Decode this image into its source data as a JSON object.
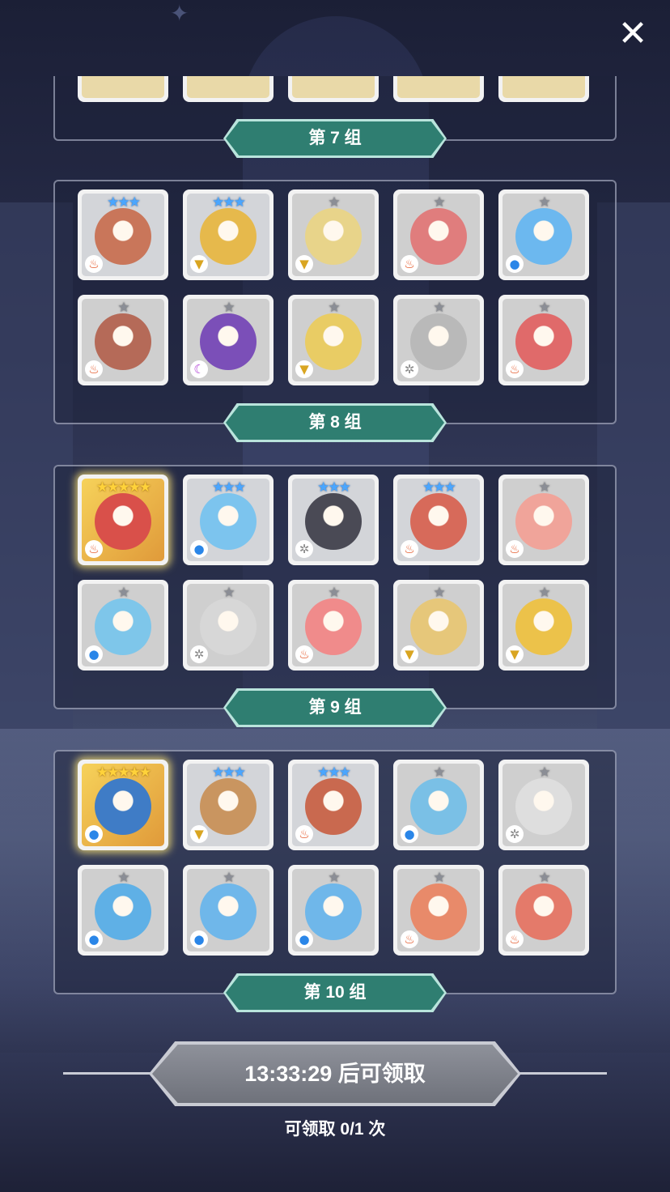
{
  "header": {
    "close_icon": "close-icon"
  },
  "groups": [
    {
      "label": "第 7 组",
      "partial": true
    },
    {
      "label": "第 8 组",
      "cards": [
        {
          "stars": 3,
          "star_color": "blue",
          "element": "fire",
          "color": "#c9765a"
        },
        {
          "stars": 3,
          "star_color": "blue",
          "element": "earth",
          "color": "#e6b94c"
        },
        {
          "stars": 1,
          "star_color": "grey",
          "element": "earth",
          "color": "#e8d48a"
        },
        {
          "stars": 1,
          "star_color": "grey",
          "element": "fire",
          "color": "#e07d7d"
        },
        {
          "stars": 1,
          "star_color": "grey",
          "element": "water",
          "color": "#6cb8ef"
        },
        {
          "stars": 1,
          "star_color": "grey",
          "element": "fire",
          "color": "#b56a58"
        },
        {
          "stars": 1,
          "star_color": "grey",
          "element": "dark",
          "color": "#7b4fb8"
        },
        {
          "stars": 1,
          "star_color": "grey",
          "element": "earth",
          "color": "#e9cc64"
        },
        {
          "stars": 1,
          "star_color": "grey",
          "element": "light",
          "color": "#b9b9b9"
        },
        {
          "stars": 1,
          "star_color": "grey",
          "element": "fire",
          "color": "#e06a6a"
        }
      ]
    },
    {
      "label": "第 9 组",
      "cards": [
        {
          "stars": 5,
          "star_color": "gold",
          "element": "fire",
          "color": "#d9504a"
        },
        {
          "stars": 3,
          "star_color": "blue",
          "element": "water",
          "color": "#7cc4ee"
        },
        {
          "stars": 3,
          "star_color": "blue",
          "element": "light",
          "color": "#4a4a55"
        },
        {
          "stars": 3,
          "star_color": "blue",
          "element": "fire",
          "color": "#d76a5a"
        },
        {
          "stars": 1,
          "star_color": "grey",
          "element": "fire",
          "color": "#f0a49a"
        },
        {
          "stars": 1,
          "star_color": "grey",
          "element": "water",
          "color": "#7ec6ea"
        },
        {
          "stars": 1,
          "star_color": "grey",
          "element": "light",
          "color": "#d7d7d7"
        },
        {
          "stars": 1,
          "star_color": "grey",
          "element": "fire",
          "color": "#f08b8b"
        },
        {
          "stars": 1,
          "star_color": "grey",
          "element": "earth",
          "color": "#e6c77a"
        },
        {
          "stars": 1,
          "star_color": "grey",
          "element": "earth",
          "color": "#ecc24a"
        }
      ]
    },
    {
      "label": "第 10 组",
      "cards": [
        {
          "stars": 5,
          "star_color": "gold",
          "element": "water",
          "color": "#3f7cc6"
        },
        {
          "stars": 3,
          "star_color": "blue",
          "element": "earth",
          "color": "#c99560"
        },
        {
          "stars": 3,
          "star_color": "blue",
          "element": "fire",
          "color": "#c9694f"
        },
        {
          "stars": 1,
          "star_color": "grey",
          "element": "water",
          "color": "#7ac0e6"
        },
        {
          "stars": 1,
          "star_color": "grey",
          "element": "light",
          "color": "#dedede"
        },
        {
          "stars": 1,
          "star_color": "grey",
          "element": "water",
          "color": "#5fb0e6"
        },
        {
          "stars": 1,
          "star_color": "grey",
          "element": "water",
          "color": "#6fb7ea"
        },
        {
          "stars": 1,
          "star_color": "grey",
          "element": "water",
          "color": "#6fb7ea"
        },
        {
          "stars": 1,
          "star_color": "grey",
          "element": "fire",
          "color": "#e88a6a"
        },
        {
          "stars": 1,
          "star_color": "grey",
          "element": "fire",
          "color": "#e47a6a"
        }
      ]
    }
  ],
  "footer": {
    "claim_button": "13:33:29 后可领取",
    "claim_count": "可领取 0/1 次"
  },
  "element_icons": {
    "fire": "fire-icon",
    "water": "water-drop-icon",
    "earth": "earth-icon",
    "light": "light-gear-icon",
    "dark": "dark-moon-icon"
  }
}
